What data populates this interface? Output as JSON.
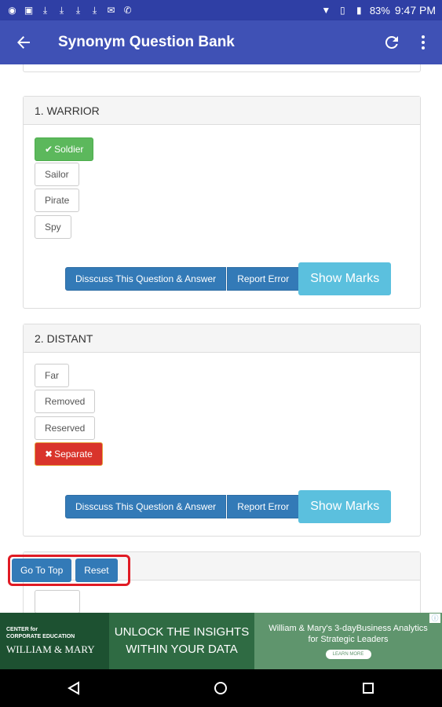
{
  "status": {
    "battery": "83%",
    "time": "9:47 PM"
  },
  "appbar": {
    "title": "Synonym Question Bank",
    "back_icon": "arrow-left-icon",
    "refresh_icon": "refresh-icon",
    "more_icon": "more-vert-icon"
  },
  "questions": [
    {
      "heading": "1. WARRIOR",
      "options": [
        "Soldier",
        "Sailor",
        "Pirate",
        "Spy"
      ],
      "selected": "Soldier",
      "selected_state": "correct"
    },
    {
      "heading": "2. DISTANT",
      "options": [
        "Far",
        "Removed",
        "Reserved",
        "Separate"
      ],
      "selected": "Separate",
      "selected_state": "wrong"
    }
  ],
  "actions": {
    "discuss": "Disscuss This Question & Answer",
    "report": "Report Error",
    "show_marks": "Show Marks"
  },
  "floating": {
    "go_top": "Go To Top",
    "reset": "Reset"
  },
  "ad": {
    "org_line1": "CENTER for",
    "org_line2": "CORPORATE EDUCATION",
    "org_name": "WILLIAM & MARY",
    "headline1": "UNLOCK THE INSIGHTS",
    "headline2": "WITHIN YOUR DATA",
    "body1": "William & Mary's 3-dayBusiness Analytics",
    "body2": "for Strategic Leaders",
    "cta": "LEARN MORE"
  },
  "colors": {
    "appbar": "#3f51b5",
    "correct": "#5cb85c",
    "wrong": "#d9342b",
    "primary": "#337ab7",
    "info": "#5bc0de"
  }
}
